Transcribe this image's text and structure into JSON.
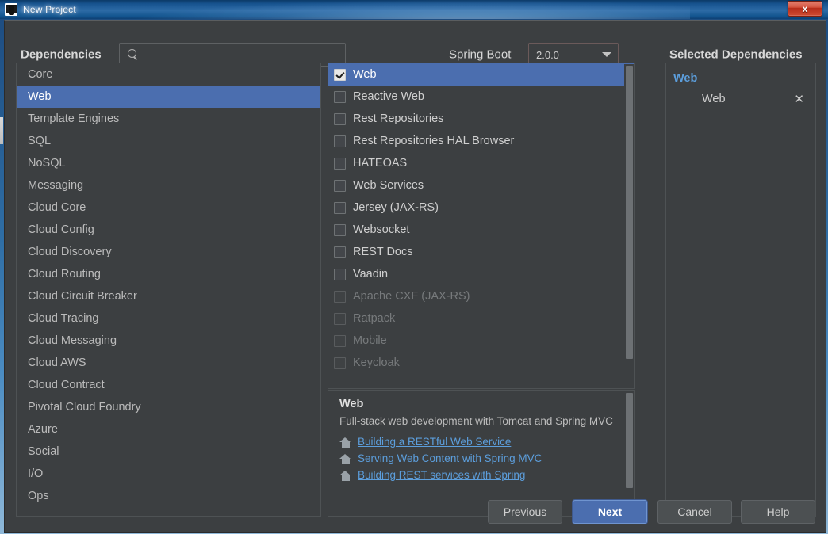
{
  "window": {
    "title": "New Project",
    "app_icon": "intellij-idea-icon",
    "close_label": "x"
  },
  "header": {
    "dependencies_label": "Dependencies",
    "search": {
      "icon": "search-icon",
      "value": "",
      "placeholder": ""
    },
    "spring_boot_label": "Spring Boot",
    "version": {
      "selected": "2.0.0",
      "icon": "chevron-down-icon"
    },
    "selected_dependencies_title": "Selected Dependencies"
  },
  "categories": {
    "selected": "Web",
    "items": [
      {
        "label": "Core"
      },
      {
        "label": "Web"
      },
      {
        "label": "Template Engines"
      },
      {
        "label": "SQL"
      },
      {
        "label": "NoSQL"
      },
      {
        "label": "Messaging"
      },
      {
        "label": "Cloud Core"
      },
      {
        "label": "Cloud Config"
      },
      {
        "label": "Cloud Discovery"
      },
      {
        "label": "Cloud Routing"
      },
      {
        "label": "Cloud Circuit Breaker"
      },
      {
        "label": "Cloud Tracing"
      },
      {
        "label": "Cloud Messaging"
      },
      {
        "label": "Cloud AWS"
      },
      {
        "label": "Cloud Contract"
      },
      {
        "label": "Pivotal Cloud Foundry"
      },
      {
        "label": "Azure"
      },
      {
        "label": "Social"
      },
      {
        "label": "I/O"
      },
      {
        "label": "Ops"
      }
    ]
  },
  "dependencies": {
    "items": [
      {
        "label": "Web",
        "checked": true,
        "disabled": false,
        "selected": true
      },
      {
        "label": "Reactive Web",
        "checked": false,
        "disabled": false,
        "selected": false
      },
      {
        "label": "Rest Repositories",
        "checked": false,
        "disabled": false,
        "selected": false
      },
      {
        "label": "Rest Repositories HAL Browser",
        "checked": false,
        "disabled": false,
        "selected": false
      },
      {
        "label": "HATEOAS",
        "checked": false,
        "disabled": false,
        "selected": false
      },
      {
        "label": "Web Services",
        "checked": false,
        "disabled": false,
        "selected": false
      },
      {
        "label": "Jersey (JAX-RS)",
        "checked": false,
        "disabled": false,
        "selected": false
      },
      {
        "label": "Websocket",
        "checked": false,
        "disabled": false,
        "selected": false
      },
      {
        "label": "REST Docs",
        "checked": false,
        "disabled": false,
        "selected": false
      },
      {
        "label": "Vaadin",
        "checked": false,
        "disabled": false,
        "selected": false
      },
      {
        "label": "Apache CXF (JAX-RS)",
        "checked": false,
        "disabled": true,
        "selected": false
      },
      {
        "label": "Ratpack",
        "checked": false,
        "disabled": true,
        "selected": false
      },
      {
        "label": "Mobile",
        "checked": false,
        "disabled": true,
        "selected": false
      },
      {
        "label": "Keycloak",
        "checked": false,
        "disabled": true,
        "selected": false
      }
    ]
  },
  "description": {
    "title": "Web",
    "text": "Full-stack web development with Tomcat and Spring MVC",
    "links": [
      {
        "label": "Building a RESTful Web Service",
        "icon": "home-icon"
      },
      {
        "label": "Serving Web Content with Spring MVC",
        "icon": "home-icon"
      },
      {
        "label": "Building REST services with Spring",
        "icon": "home-icon"
      }
    ]
  },
  "selected_dependencies": {
    "group": "Web",
    "items": [
      {
        "label": "Web",
        "remove_icon": "close-icon",
        "remove_label": "✕"
      }
    ]
  },
  "buttons": {
    "previous": "Previous",
    "next": "Next",
    "cancel": "Cancel",
    "help": "Help"
  }
}
